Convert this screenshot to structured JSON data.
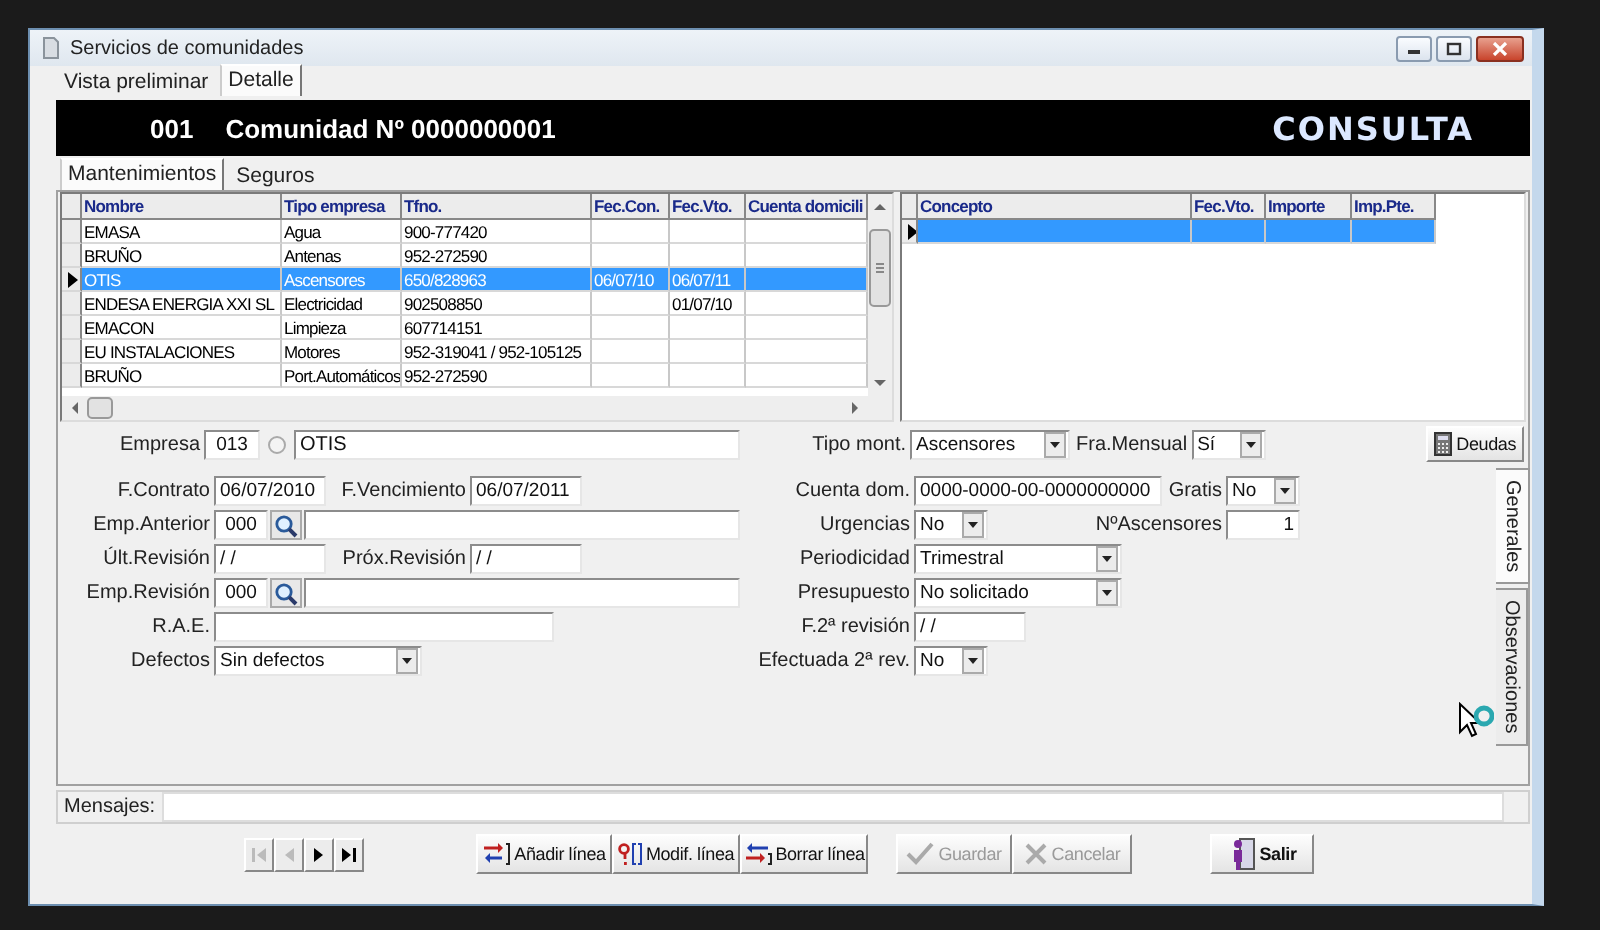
{
  "window": {
    "title": "Servicios de comunidades"
  },
  "view_tabs": [
    {
      "label": "Vista preliminar",
      "selected": false
    },
    {
      "label": "Detalle",
      "selected": true
    }
  ],
  "header": {
    "code": "001",
    "title": "Comunidad Nº 0000000001",
    "mode": "CONSULTA"
  },
  "section_tabs": [
    {
      "label": "Mantenimientos",
      "selected": true
    },
    {
      "label": "Seguros",
      "selected": false
    }
  ],
  "maintenance_table": {
    "columns": [
      "Nombre",
      "Tipo empresa",
      "Tfno.",
      "Fec.Con.",
      "Fec.Vto.",
      "Cuenta domicili"
    ],
    "rows": [
      {
        "name": "EMASA",
        "type": "Agua",
        "phone": "900-777420",
        "selected": false
      },
      {
        "name": "BRUÑO",
        "type": "Antenas",
        "phone": "952-272590",
        "selected": false
      },
      {
        "name": "OTIS",
        "type": "Ascensores",
        "phone": "650/828963",
        "contract_date": "06/07/10",
        "expiry_date": "06/07/11",
        "selected": true
      },
      {
        "name": "ENDESA ENERGIA XXI SL",
        "type": "Electricidad",
        "phone": "902508850",
        "expiry_date": "01/07/10",
        "selected": false
      },
      {
        "name": "EMACON",
        "type": "Limpieza",
        "phone": "607714151",
        "selected": false
      },
      {
        "name": "EU INSTALACIONES",
        "type": "Motores",
        "phone": "952-319041 / 952-105125",
        "selected": false
      },
      {
        "name": "BRUÑO",
        "type": "Port.Automáticos",
        "phone": "952-272590",
        "selected": false
      }
    ]
  },
  "debts_table": {
    "columns": [
      "Concepto",
      "Fec.Vto.",
      "Importe",
      "Imp.Pte."
    ],
    "rows": [
      {
        "selected": true
      }
    ]
  },
  "company": {
    "label": "Empresa",
    "code": "013",
    "name": "OTIS"
  },
  "contract_selectors": [
    {
      "label": "Tipo mont.",
      "value": "Ascensores"
    },
    {
      "label": "Fra.Mensual",
      "value": "Sí"
    }
  ],
  "debts_button": {
    "label": "Deudas"
  },
  "general_form": {
    "left": [
      [
        {
          "label": "F.Contrato",
          "kind": "date",
          "value": "06/07/2010"
        },
        {
          "label": "F.Vencimiento",
          "kind": "date",
          "value": "06/07/2011"
        }
      ],
      [
        {
          "label": "Emp.Anterior",
          "kind": "lookup",
          "value": "000"
        }
      ],
      [
        {
          "label": "Últ.Revisión",
          "kind": "date",
          "value": "/ /"
        },
        {
          "label": "Próx.Revisión",
          "kind": "date",
          "value": "/ /"
        }
      ],
      [
        {
          "label": "Emp.Revisión",
          "kind": "lookup",
          "value": "000"
        }
      ],
      [
        {
          "label": "R.A.E.",
          "kind": "text"
        }
      ],
      [
        {
          "label": "Defectos",
          "kind": "dropdown",
          "value": "Sin defectos"
        }
      ]
    ],
    "right": [
      [
        {
          "label": "Cuenta dom.",
          "kind": "account",
          "value": "0000-0000-00-0000000000"
        },
        {
          "label": "Gratis",
          "kind": "choice",
          "value": "No"
        }
      ],
      [
        {
          "label": "Urgencias",
          "kind": "choice",
          "value": "No"
        },
        {
          "label": "NºAscensores",
          "kind": "count",
          "value": "1"
        }
      ],
      [
        {
          "label": "Periodicidad",
          "kind": "dropdown",
          "value": "Trimestral"
        }
      ],
      [
        {
          "label": "Presupuesto",
          "kind": "dropdown",
          "value": "No solicitado"
        }
      ],
      [
        {
          "label": "F.2ª revisión",
          "kind": "date",
          "value": "/ /"
        }
      ],
      [
        {
          "label": "Efectuada 2ª rev.",
          "kind": "choice",
          "value": "No"
        }
      ]
    ]
  },
  "side_tabs": [
    {
      "label": "Generales",
      "selected": true
    },
    {
      "label": "Observaciones",
      "selected": false
    }
  ],
  "messages": {
    "label": "Mensajes:"
  },
  "navigation": [
    {
      "kind": "first",
      "disabled": true
    },
    {
      "kind": "prev",
      "disabled": true
    },
    {
      "kind": "next",
      "disabled": false
    },
    {
      "kind": "last",
      "disabled": false
    }
  ],
  "actions": [
    {
      "kind": "add",
      "label": "Añadir línea",
      "disabled": false
    },
    {
      "kind": "edit",
      "label": "Modif. línea",
      "disabled": false
    },
    {
      "kind": "delete",
      "label": "Borrar línea",
      "disabled": false
    },
    {
      "kind": "save",
      "label": "Guardar",
      "disabled": true
    },
    {
      "kind": "cancel",
      "label": "Cancelar",
      "disabled": true
    },
    {
      "kind": "exit",
      "label": "Salir",
      "disabled": false
    }
  ]
}
